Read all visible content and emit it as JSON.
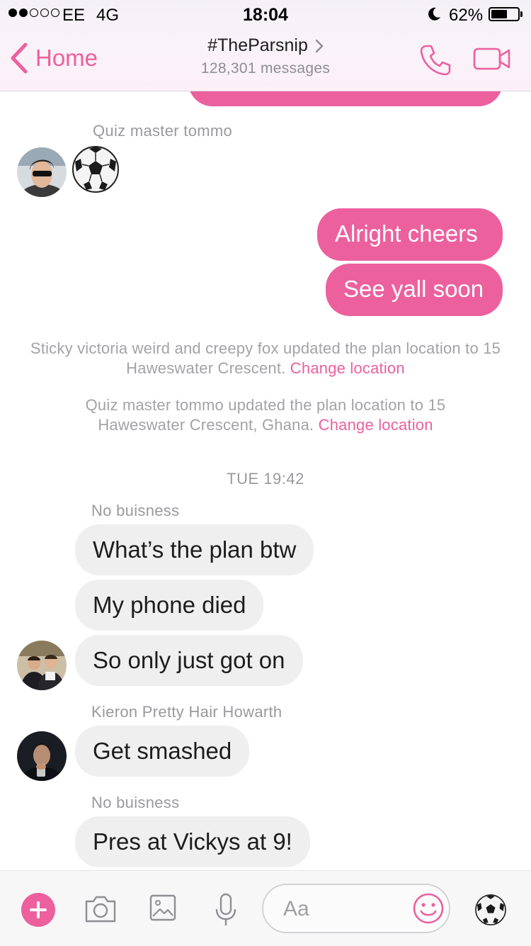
{
  "status_bar": {
    "carrier": "EE",
    "network": "4G",
    "time": "18:04",
    "battery_percent": "62%",
    "battery_level": 0.62,
    "signal_bars": 2
  },
  "header": {
    "back_label": "Home",
    "title": "#TheParsnip",
    "subtitle": "128,301 messages",
    "icons": [
      "chevron-left-icon",
      "chevron-right-icon",
      "phone-icon",
      "video-camera-icon"
    ]
  },
  "conversation": {
    "sender_1": "Quiz master tommo",
    "reply_1": "Alright cheers",
    "reply_2": "See yall soon",
    "sys_1_text": "Sticky victoria weird and creepy fox updated the plan location to 15 Haweswater Crescent.",
    "sys_1_link": "Change location",
    "sys_2_text": "Quiz master tommo updated the plan location to 15 Haweswater Crescent, Ghana.",
    "sys_2_link": "Change location",
    "timestamp": "TUE 19:42",
    "sender_2": "No buisness",
    "msg_1": "What’s the plan btw",
    "msg_2": "My phone died",
    "msg_3": "So only just got on",
    "sender_3": "Kieron Pretty Hair Howarth",
    "msg_4": "Get smashed",
    "sender_4": "No buisness",
    "msg_5": "Pres at Vickys at 9!"
  },
  "composer": {
    "placeholder": "Aa",
    "icons": [
      "plus-icon",
      "camera-icon",
      "gallery-icon",
      "microphone-icon",
      "smiley-icon",
      "soccer-ball-icon"
    ]
  },
  "colors": {
    "accent": "#ec609e",
    "outgoing_bubble": "#ec609e",
    "incoming_bubble": "#efefef",
    "meta_text": "#9a9a9e"
  }
}
